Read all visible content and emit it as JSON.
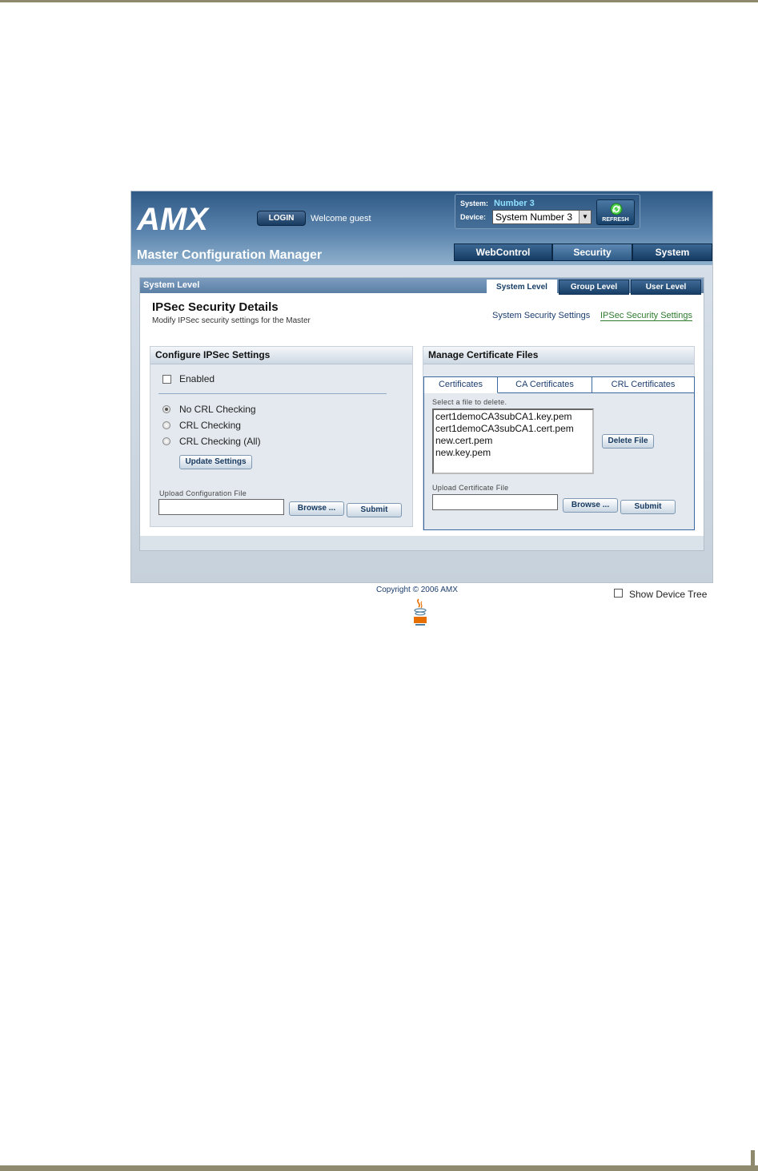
{
  "header": {
    "logo_text": "AMX",
    "login_label": "LOGIN",
    "welcome_text": "Welcome guest",
    "app_title": "Master Configuration Manager",
    "system_label": "System:",
    "system_value": "Number 3",
    "device_label": "Device:",
    "device_value": "System Number 3",
    "refresh_label": "REFRESH",
    "nav_tabs": [
      {
        "label": "WebControl",
        "active": false
      },
      {
        "label": "Security",
        "active": true
      },
      {
        "label": "System",
        "active": false
      }
    ]
  },
  "panel": {
    "bar_title": "System Level",
    "level_tabs": [
      {
        "label": "System Level",
        "active": true
      },
      {
        "label": "Group Level",
        "active": false
      },
      {
        "label": "User Level",
        "active": false
      }
    ],
    "page_title": "IPSec Security Details",
    "page_subtitle": "Modify IPSec security settings for the Master",
    "links": [
      "System Security Settings",
      "IPSec Security Settings"
    ]
  },
  "configure": {
    "title": "Configure IPSec Settings",
    "enabled_label": "Enabled",
    "enabled_checked": false,
    "radios": [
      {
        "label": "No CRL Checking",
        "selected": true
      },
      {
        "label": "CRL Checking",
        "selected": false
      },
      {
        "label": "CRL Checking (All)",
        "selected": false
      }
    ],
    "update_button": "Update Settings",
    "upload_label": "Upload Configuration File",
    "browse_button": "Browse ...",
    "submit_button": "Submit"
  },
  "certificates": {
    "title": "Manage Certificate Files",
    "tabs": [
      {
        "label": "Certificates",
        "active": true
      },
      {
        "label": "CA Certificates",
        "active": false
      },
      {
        "label": "CRL Certificates",
        "active": false
      }
    ],
    "select_label": "Select a file to delete.",
    "files": [
      "cert1demoCA3subCA1.key.pem",
      "cert1demoCA3subCA1.cert.pem",
      "new.cert.pem",
      "new.key.pem"
    ],
    "delete_button": "Delete File",
    "upload_label": "Upload Certificate File",
    "browse_button": "Browse ...",
    "submit_button": "Submit"
  },
  "footer": {
    "copyright": "Copyright © 2006 AMX",
    "show_tree_label": "Show Device Tree",
    "show_tree_checked": false
  },
  "colors": {
    "header_dark": "#2f5a86",
    "accent_link": "#2e7a2e",
    "nav_tab": "#143a61"
  }
}
